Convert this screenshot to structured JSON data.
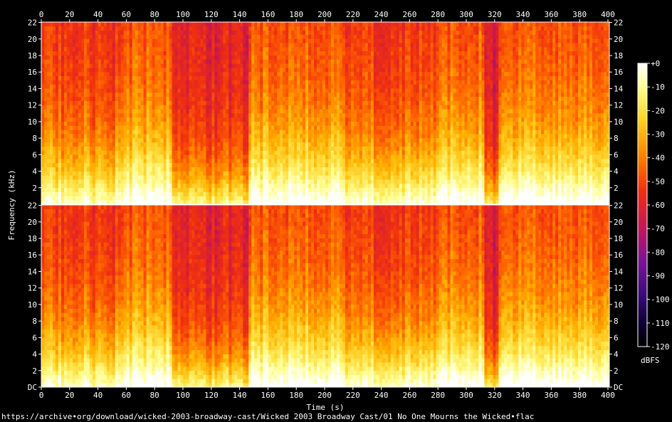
{
  "source_url": "https://archive•org/download/wicked-2003-broadway-cast/Wicked 2003 Broadway Cast/01 No One Mourns the Wicked•flac",
  "colorbar_label": "dBFS",
  "colorbar_ticks": [
    "+0",
    "-10",
    "-20",
    "-30",
    "-40",
    "-50",
    "-60",
    "-70",
    "-80",
    "-90",
    "-100",
    "-110",
    "-120"
  ],
  "colors": {
    "background": "#000000",
    "frame": "#ffffff",
    "colormap": [
      "#000000",
      "#1c0060",
      "#5a0fa0",
      "#9a1080",
      "#d01a40",
      "#f03010",
      "#ff6a00",
      "#ffb000",
      "#ffe040",
      "#ffff99",
      "#ffffff"
    ]
  },
  "chart_data": {
    "type": "heatmap",
    "xlabel": "Time (s)",
    "ylabel": "Frequency (kHz)",
    "x_ticks": [
      0,
      20,
      40,
      60,
      80,
      100,
      120,
      140,
      160,
      180,
      200,
      220,
      240,
      260,
      280,
      300,
      320,
      340,
      360,
      380,
      400
    ],
    "xlim": [
      0,
      401
    ],
    "channels": [
      {
        "y_ticks": [
          2,
          4,
          6,
          8,
          10,
          12,
          14,
          16,
          18,
          20,
          22
        ],
        "ylim": [
          0,
          22.05
        ]
      },
      {
        "y_ticks": [
          "DC",
          "2",
          "4",
          "6",
          "8",
          "10",
          "12",
          "14",
          "16",
          "18",
          "20",
          "22"
        ],
        "ylim": [
          0,
          22.05
        ]
      }
    ],
    "value_range": [
      -120,
      0
    ],
    "value_unit": "dBFS",
    "bright_segments": [
      {
        "t0": 0,
        "t1": 36,
        "energy": 0.55
      },
      {
        "t0": 36,
        "t1": 52,
        "energy": 0.5
      },
      {
        "t0": 52,
        "t1": 93,
        "energy": 0.7
      },
      {
        "t0": 93,
        "t1": 147,
        "energy": 0.35
      },
      {
        "t0": 147,
        "t1": 215,
        "energy": 0.7
      },
      {
        "t0": 215,
        "t1": 279,
        "energy": 0.55
      },
      {
        "t0": 279,
        "t1": 313,
        "energy": 0.7
      },
      {
        "t0": 313,
        "t1": 323,
        "energy": 0.25
      },
      {
        "t0": 323,
        "t1": 401,
        "energy": 0.7
      }
    ]
  }
}
